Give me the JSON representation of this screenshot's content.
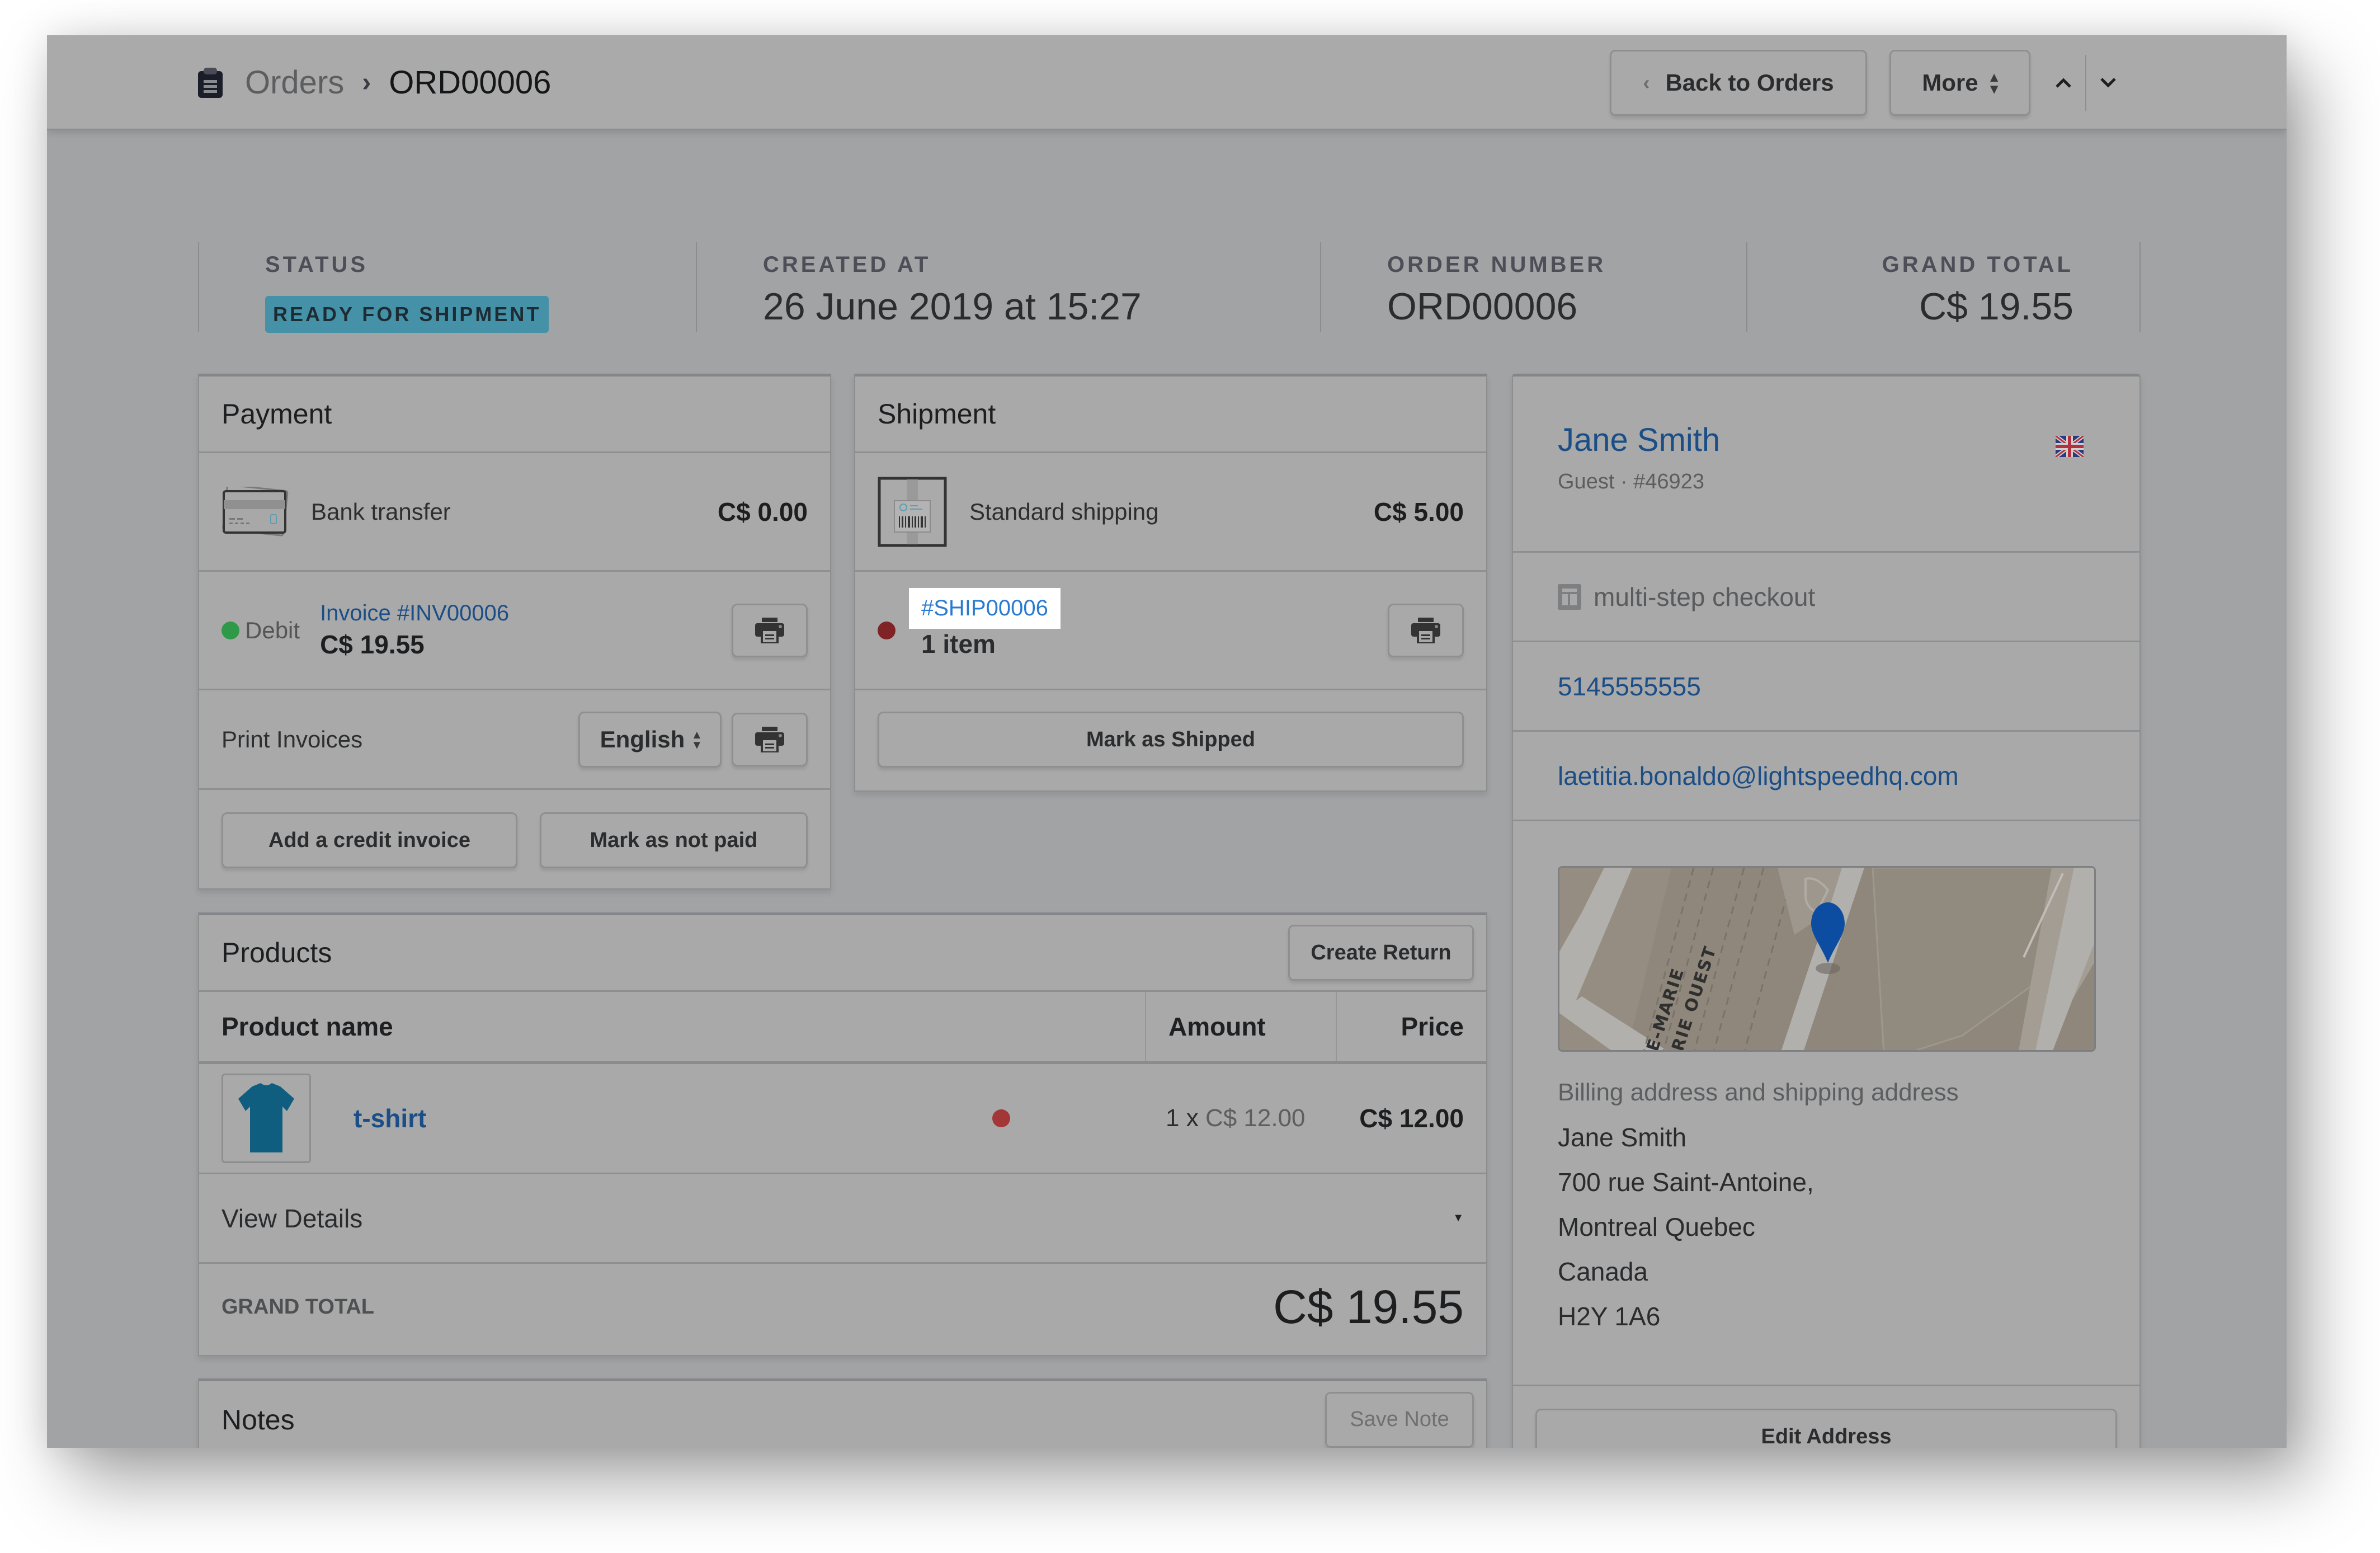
{
  "breadcrumb": {
    "icon": "clipboard-icon",
    "parent": "Orders",
    "separator": "›",
    "current": "ORD00006"
  },
  "toolbar": {
    "back_label": "Back to Orders",
    "back_icon": "‹",
    "more_label": "More",
    "prev_icon": "^",
    "next_icon": "v"
  },
  "stats": {
    "status_label": "STATUS",
    "status_value": "READY FOR SHIPMENT",
    "created_label": "CREATED AT",
    "created_value": "26 June 2019 at 15:27",
    "order_number_label": "ORDER NUMBER",
    "order_number_value": "ORD00006",
    "grand_total_label": "GRAND TOTAL",
    "grand_total_value": "C$ 19.55"
  },
  "payment": {
    "title": "Payment",
    "method": "Bank transfer",
    "method_amount": "C$ 0.00",
    "debit_label": "Debit",
    "invoice_link": "Invoice #INV00006",
    "invoice_amount": "C$ 19.55",
    "print_invoices_label": "Print Invoices",
    "language_selected": "English",
    "add_credit_label": "Add a credit invoice",
    "mark_not_paid_label": "Mark as not paid"
  },
  "shipment": {
    "title": "Shipment",
    "method": "Standard shipping",
    "method_amount": "C$ 5.00",
    "shipment_link": "#SHIP00006",
    "item_count": "1 item",
    "mark_shipped_label": "Mark as Shipped"
  },
  "products": {
    "title": "Products",
    "create_return_label": "Create Return",
    "columns": [
      "Product name",
      "Amount",
      "Price"
    ],
    "rows": [
      {
        "name": "t-shirt",
        "quantity_text": "1 x",
        "unit_price": "C$ 12.00",
        "price": "C$ 12.00"
      }
    ],
    "view_details_label": "View Details",
    "grand_total_label": "GRAND TOTAL",
    "grand_total_value": "C$ 19.55"
  },
  "notes": {
    "title": "Notes",
    "save_label": "Save Note"
  },
  "customer": {
    "name": "Jane Smith",
    "subtitle": "Guest · #46923",
    "flag": "uk-flag-icon",
    "checkout_type": "multi-step checkout",
    "phone": "5145555555",
    "email": "laetitia.bonaldo@lightspeedhq.com",
    "map_labels": [
      "E-MARIE",
      "RIE OUEST"
    ],
    "address_heading": "Billing address and shipping address",
    "address_lines": [
      "Jane Smith",
      "700 rue Saint-Antoine,",
      "Montreal Quebec",
      "Canada",
      "H2Y 1A6"
    ],
    "edit_address_label": "Edit Address"
  },
  "colors": {
    "badge": "#4591a8",
    "link": "#1b4e87",
    "green_dot": "#2e9a47",
    "red_dot": "#a33636",
    "highlight_link": "#2a7bd0"
  }
}
